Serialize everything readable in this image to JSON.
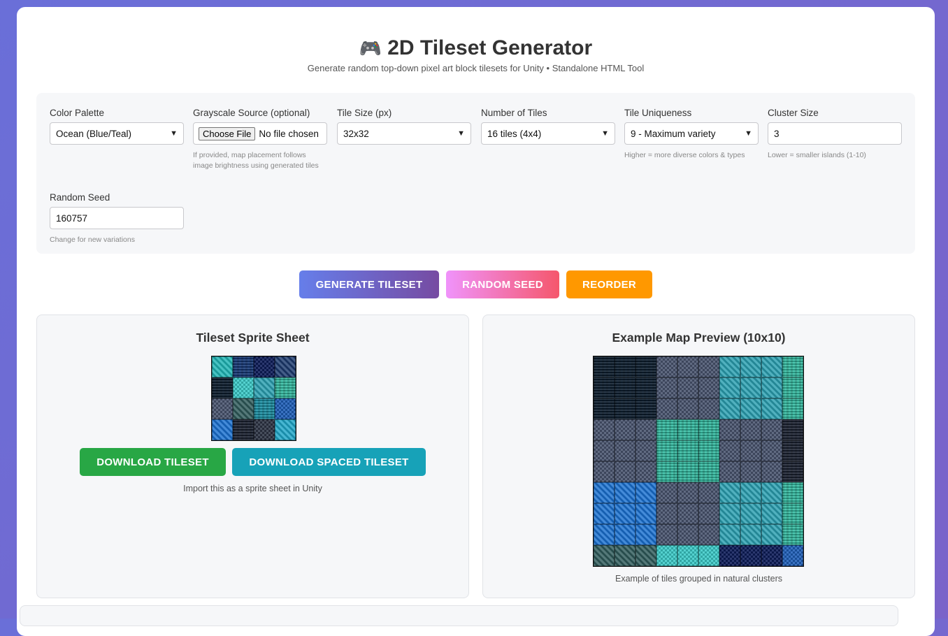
{
  "header": {
    "icon": "game-controller-icon",
    "title": "2D Tileset Generator",
    "subtitle": "Generate random top-down pixel art block tilesets for Unity • Standalone HTML Tool"
  },
  "settings": {
    "palette": {
      "label": "Color Palette",
      "value": "Ocean (Blue/Teal)"
    },
    "grayscale": {
      "label": "Grayscale Source (optional)",
      "button": "Choose File",
      "status": "No file chosen",
      "hint": "If provided, map placement follows image brightness using generated tiles"
    },
    "tile_size": {
      "label": "Tile Size (px)",
      "value": "32x32"
    },
    "num_tiles": {
      "label": "Number of Tiles",
      "value": "16 tiles (4x4)"
    },
    "uniqueness": {
      "label": "Tile Uniqueness",
      "value": "9 - Maximum variety",
      "hint": "Higher = more diverse colors & types"
    },
    "cluster": {
      "label": "Cluster Size",
      "value": "3",
      "hint": "Lower = smaller islands (1-10)"
    },
    "seed": {
      "label": "Random Seed",
      "value": "160757",
      "hint": "Change for new variations"
    }
  },
  "actions": {
    "generate": "GENERATE TILESET",
    "random_seed": "RANDOM SEED",
    "reorder": "REORDER"
  },
  "sprite_panel": {
    "title": "Tileset Sprite Sheet",
    "download": "DOWNLOAD TILESET",
    "download_spaced": "DOWNLOAD SPACED TILESET",
    "caption": "Import this as a sprite sheet in Unity"
  },
  "map_panel": {
    "title": "Example Map Preview (10x10)",
    "caption": "Example of tiles grouped in natural clusters"
  },
  "colors": {
    "generate_gradient": [
      "#667eea",
      "#764ba2"
    ],
    "random_gradient": [
      "#f093fb",
      "#f5576c"
    ],
    "reorder": "#ff9800",
    "download": "#28a745",
    "download_spaced": "#17a2b8"
  },
  "tiles": [
    "#1fb5b5",
    "#173a7a",
    "#0e1d5a",
    "#1c3a6e",
    "#0d1e30",
    "#3ccbc8",
    "#2a9fb0",
    "#36bfa5",
    "#4a5570",
    "#2f5a5a",
    "#1c93a8",
    "#1f5fb8",
    "#1a70d0",
    "#1c2333",
    "#2e3545",
    "#1fa6c8"
  ],
  "map": [
    [
      4,
      4,
      4,
      8,
      8,
      8,
      6,
      6,
      6,
      7
    ],
    [
      4,
      4,
      4,
      8,
      8,
      8,
      6,
      6,
      6,
      7
    ],
    [
      4,
      4,
      4,
      8,
      8,
      8,
      6,
      6,
      6,
      7
    ],
    [
      8,
      8,
      8,
      7,
      7,
      7,
      8,
      8,
      8,
      13
    ],
    [
      8,
      8,
      8,
      7,
      7,
      7,
      8,
      8,
      8,
      13
    ],
    [
      8,
      8,
      8,
      7,
      7,
      7,
      8,
      8,
      8,
      13
    ],
    [
      12,
      12,
      12,
      8,
      8,
      8,
      6,
      6,
      6,
      7
    ],
    [
      12,
      12,
      12,
      8,
      8,
      8,
      6,
      6,
      6,
      7
    ],
    [
      12,
      12,
      12,
      8,
      8,
      8,
      6,
      6,
      6,
      7
    ],
    [
      9,
      9,
      9,
      5,
      5,
      5,
      2,
      2,
      2,
      11
    ]
  ]
}
